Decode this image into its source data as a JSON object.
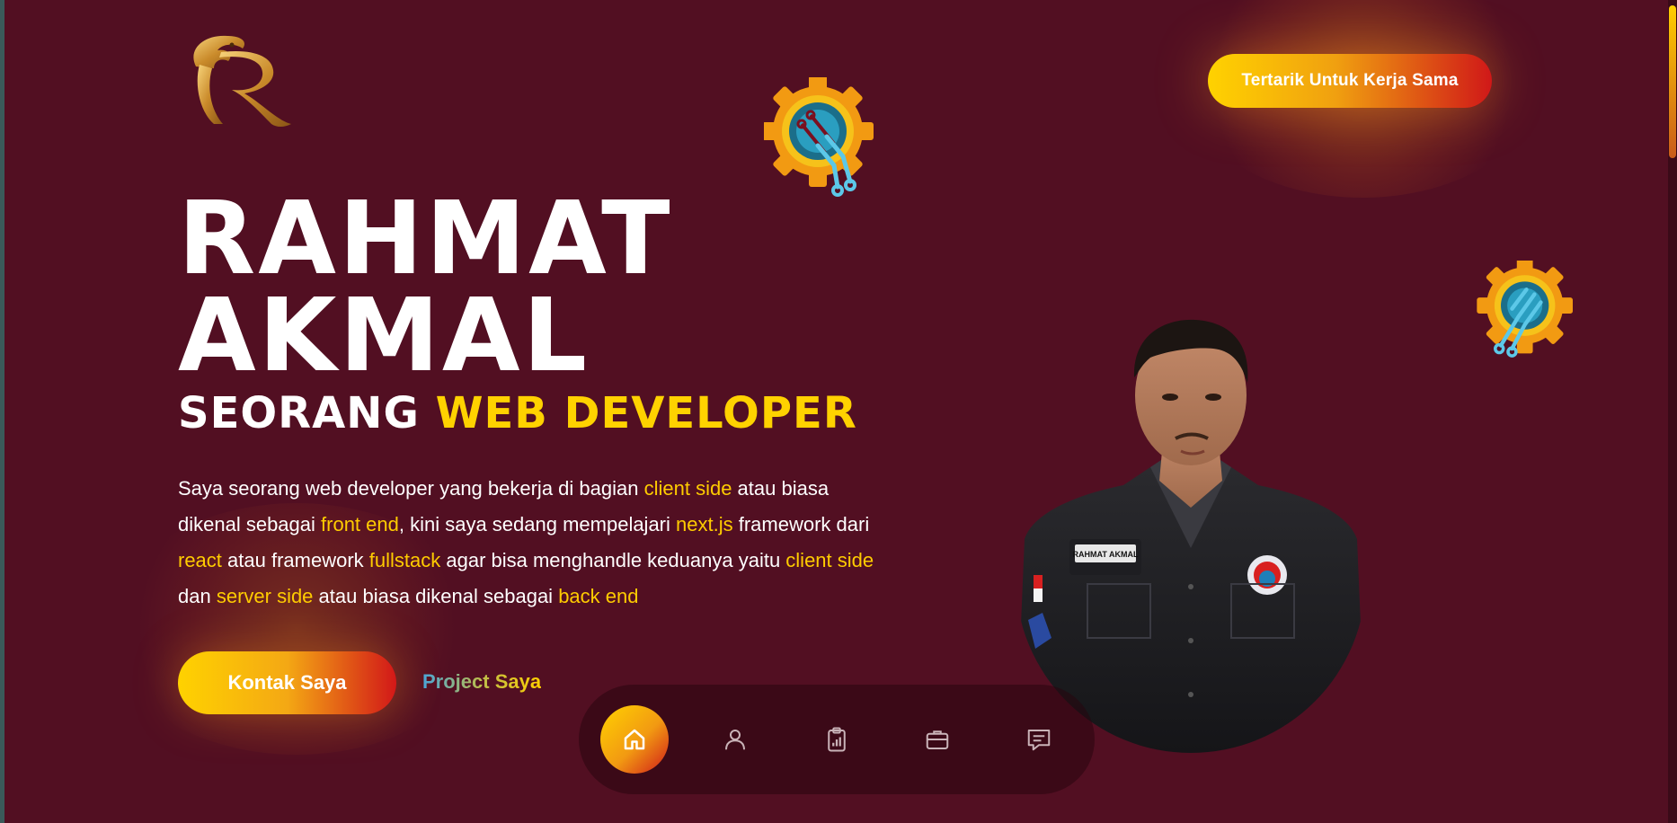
{
  "header": {
    "logo_letter": "R",
    "cta_label": "Tertarik Untuk Kerja Sama"
  },
  "hero": {
    "name_line1": "RAHMAT",
    "name_line2": "AKMAL",
    "subtitle_prefix": "SEORANG",
    "subtitle_highlight": "WEB DEVELOPER",
    "description": [
      {
        "text": "Saya seorang web developer yang bekerja di bagian ",
        "hl": false
      },
      {
        "text": "client side",
        "hl": true
      },
      {
        "text": " atau biasa dikenal sebagai ",
        "hl": false
      },
      {
        "text": "front end",
        "hl": true
      },
      {
        "text": ", kini saya sedang mempelajari ",
        "hl": false
      },
      {
        "text": "next.js",
        "hl": true
      },
      {
        "text": " framework dari ",
        "hl": false
      },
      {
        "text": "react",
        "hl": true
      },
      {
        "text": " atau framework ",
        "hl": false
      },
      {
        "text": "fullstack",
        "hl": true
      },
      {
        "text": " agar bisa menghandle keduanya yaitu ",
        "hl": false
      },
      {
        "text": "client side",
        "hl": true
      },
      {
        "text": " dan ",
        "hl": false
      },
      {
        "text": "server side",
        "hl": true
      },
      {
        "text": " atau biasa dikenal sebagai ",
        "hl": false
      },
      {
        "text": "back end",
        "hl": true
      }
    ],
    "contact_button": "Kontak Saya",
    "project_link": "Project Saya",
    "badge_name": "RAHMAT AKMAL"
  },
  "nav": {
    "items": [
      {
        "name": "home",
        "icon": "home-icon",
        "active": true
      },
      {
        "name": "about",
        "icon": "user-icon",
        "active": false
      },
      {
        "name": "skills",
        "icon": "clipboard-chart-icon",
        "active": false
      },
      {
        "name": "portfolio",
        "icon": "briefcase-icon",
        "active": false
      },
      {
        "name": "contact",
        "icon": "chat-icon",
        "active": false
      }
    ]
  },
  "colors": {
    "background": "#520f22",
    "accent_yellow": "#ffd200",
    "accent_red": "#d01818",
    "highlight_text": "#ffcc00"
  }
}
